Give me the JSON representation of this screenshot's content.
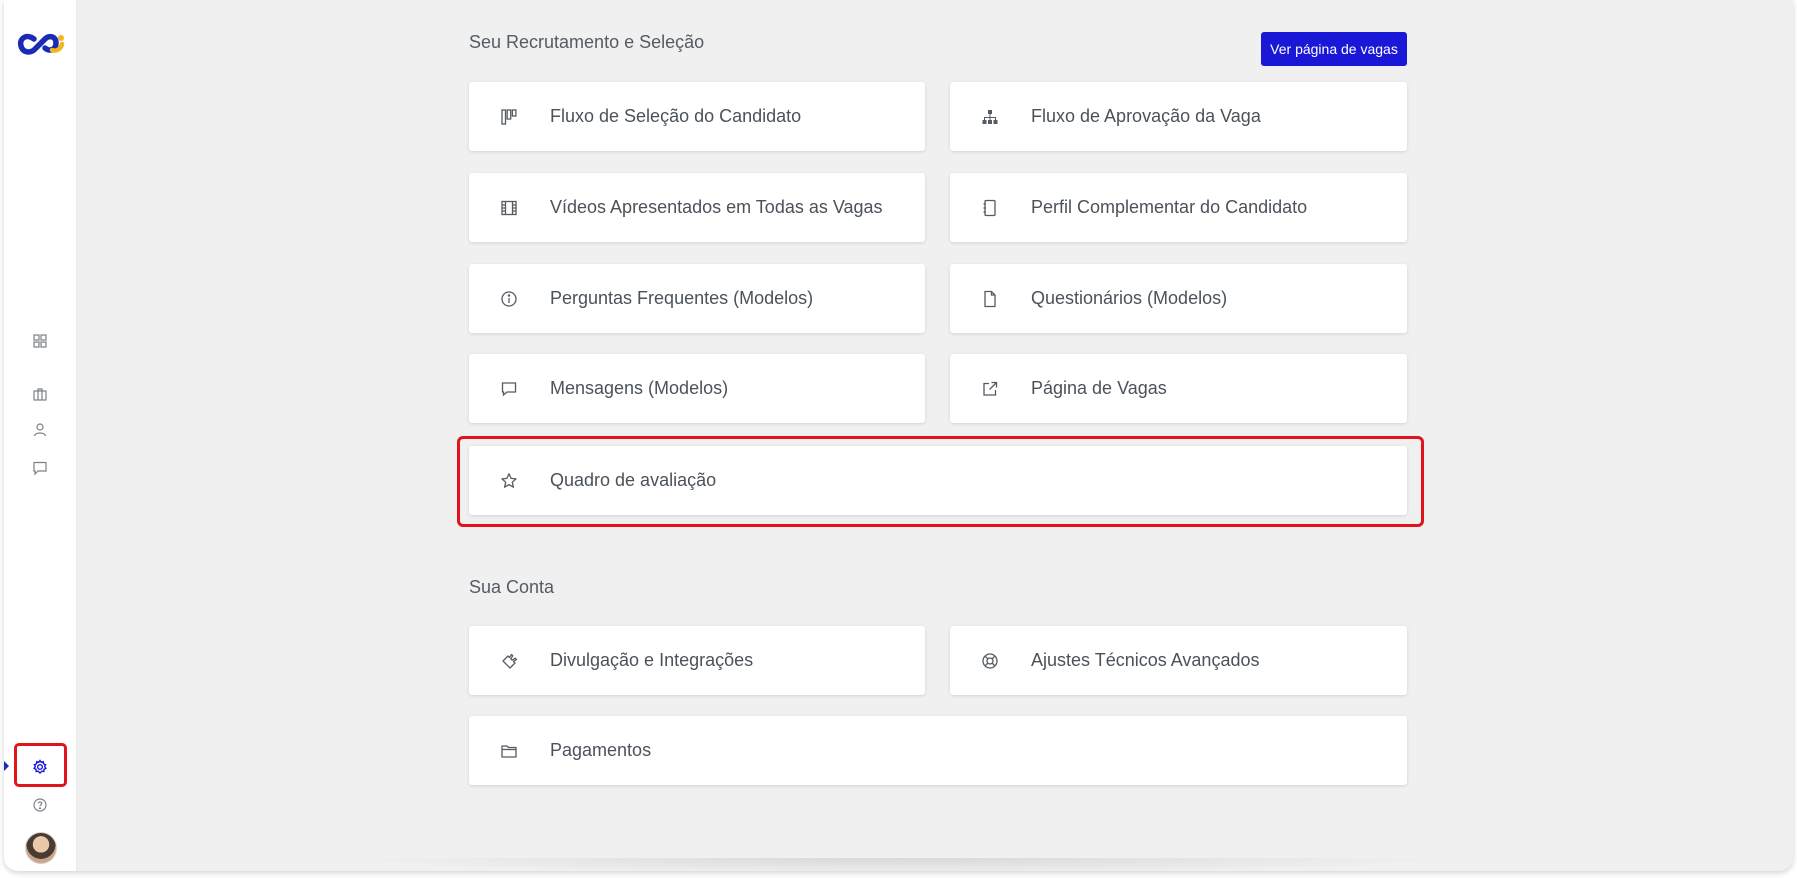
{
  "sections": {
    "recruitment_title": "Seu Recrutamento e Seleção",
    "account_title": "Sua Conta"
  },
  "header": {
    "view_jobs_button": "Ver página de vagas"
  },
  "cards": {
    "selection_flow": {
      "label": "Fluxo de Seleção do Candidato",
      "icon": "kanban-icon"
    },
    "approval_flow": {
      "label": "Fluxo de Aprovação da Vaga",
      "icon": "hierarchy-icon"
    },
    "videos": {
      "label": "Vídeos Apresentados em Todas as Vagas",
      "icon": "film-icon"
    },
    "complementary_profile": {
      "label": "Perfil Complementar do Candidato",
      "icon": "notebook-icon"
    },
    "faq": {
      "label": "Perguntas Frequentes (Modelos)",
      "icon": "info-icon"
    },
    "questionnaires": {
      "label": "Questionários (Modelos)",
      "icon": "document-icon"
    },
    "messages": {
      "label": "Mensagens (Modelos)",
      "icon": "message-icon"
    },
    "jobs_page": {
      "label": "Página de Vagas",
      "icon": "external-link-icon"
    },
    "evaluation_board": {
      "label": "Quadro de avaliação",
      "icon": "star-icon"
    },
    "integrations": {
      "label": "Divulgação e Integrações",
      "icon": "plug-icon"
    },
    "advanced_settings": {
      "label": "Ajustes Técnicos Avançados",
      "icon": "lifebuoy-icon"
    },
    "payments": {
      "label": "Pagamentos",
      "icon": "folder-icon"
    }
  },
  "sidebar": {
    "items": [
      "dashboard-icon",
      "briefcase-icon",
      "user-icon",
      "chat-icon"
    ],
    "active": "settings-icon"
  },
  "colors": {
    "accent": "#1a18d6",
    "highlight": "#e0141b",
    "logo_blue": "#1a2bb5",
    "logo_yellow": "#f2b51d"
  }
}
